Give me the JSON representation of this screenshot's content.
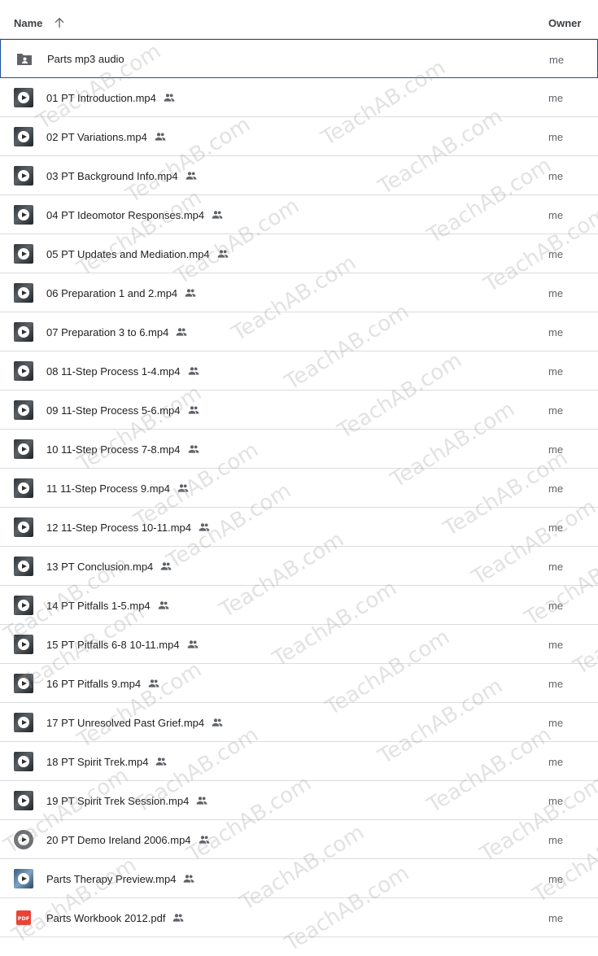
{
  "header": {
    "name_label": "Name",
    "owner_label": "Owner",
    "sort_icon": "arrow-up-icon"
  },
  "files": [
    {
      "name": "Parts mp3 audio",
      "type": "folder",
      "owner": "me",
      "shared": false,
      "selected": true
    },
    {
      "name": "01 PT Introduction.mp4",
      "type": "video",
      "owner": "me",
      "shared": true
    },
    {
      "name": "02 PT Variations.mp4",
      "type": "video",
      "owner": "me",
      "shared": true
    },
    {
      "name": "03 PT Background Info.mp4",
      "type": "video",
      "owner": "me",
      "shared": true
    },
    {
      "name": "04 PT Ideomotor Responses.mp4",
      "type": "video",
      "owner": "me",
      "shared": true
    },
    {
      "name": "05 PT Updates and Mediation.mp4",
      "type": "video",
      "owner": "me",
      "shared": true
    },
    {
      "name": "06 Preparation 1 and 2.mp4",
      "type": "video",
      "owner": "me",
      "shared": true
    },
    {
      "name": "07 Preparation 3 to 6.mp4",
      "type": "video",
      "owner": "me",
      "shared": true
    },
    {
      "name": "08 11-Step Process 1-4.mp4",
      "type": "video",
      "owner": "me",
      "shared": true
    },
    {
      "name": "09 11-Step Process 5-6.mp4",
      "type": "video",
      "owner": "me",
      "shared": true
    },
    {
      "name": "10 11-Step Process 7-8.mp4",
      "type": "video",
      "owner": "me",
      "shared": true
    },
    {
      "name": "11 11-Step Process 9.mp4",
      "type": "video",
      "owner": "me",
      "shared": true
    },
    {
      "name": "12 11-Step Process 10-11.mp4",
      "type": "video",
      "owner": "me",
      "shared": true
    },
    {
      "name": "13 PT Conclusion.mp4",
      "type": "video",
      "owner": "me",
      "shared": true
    },
    {
      "name": "14 PT Pitfalls 1-5.mp4",
      "type": "video",
      "owner": "me",
      "shared": true
    },
    {
      "name": "15 PT Pitfalls 6-8 10-11.mp4",
      "type": "video",
      "owner": "me",
      "shared": true
    },
    {
      "name": "16 PT Pitfalls 9.mp4",
      "type": "video",
      "owner": "me",
      "shared": true
    },
    {
      "name": "17 PT Unresolved Past Grief.mp4",
      "type": "video",
      "owner": "me",
      "shared": true
    },
    {
      "name": "18 PT Spirit Trek.mp4",
      "type": "video",
      "owner": "me",
      "shared": true
    },
    {
      "name": "19 PT Spirit Trek Session.mp4",
      "type": "video",
      "owner": "me",
      "shared": true
    },
    {
      "name": "20 PT Demo Ireland 2006.mp4",
      "type": "video-round",
      "owner": "me",
      "shared": true
    },
    {
      "name": "Parts Therapy Preview.mp4",
      "type": "video-blue",
      "owner": "me",
      "shared": true
    },
    {
      "name": "Parts Workbook 2012.pdf",
      "type": "pdf",
      "owner": "me",
      "shared": true
    }
  ],
  "icons": {
    "folder": "shared-folder-icon",
    "video": "video-thumbnail-icon",
    "pdf": "pdf-icon",
    "shared": "people-icon"
  },
  "pdf_badge": "PDF",
  "watermark_text": "TeachAB.com",
  "colors": {
    "selected_border": "#1a4fa0",
    "pdf_red": "#ea4335",
    "icon_gray": "#5f6368"
  }
}
